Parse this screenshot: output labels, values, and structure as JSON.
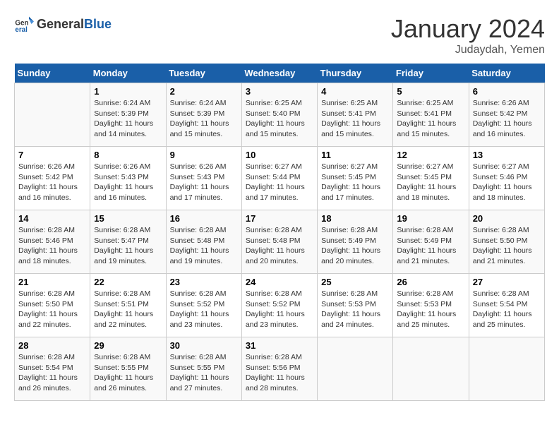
{
  "header": {
    "logo_general": "General",
    "logo_blue": "Blue",
    "month": "January 2024",
    "location": "Judaydah, Yemen"
  },
  "weekdays": [
    "Sunday",
    "Monday",
    "Tuesday",
    "Wednesday",
    "Thursday",
    "Friday",
    "Saturday"
  ],
  "weeks": [
    [
      {
        "day": "",
        "info": ""
      },
      {
        "day": "1",
        "info": "Sunrise: 6:24 AM\nSunset: 5:39 PM\nDaylight: 11 hours and 14 minutes."
      },
      {
        "day": "2",
        "info": "Sunrise: 6:24 AM\nSunset: 5:39 PM\nDaylight: 11 hours and 15 minutes."
      },
      {
        "day": "3",
        "info": "Sunrise: 6:25 AM\nSunset: 5:40 PM\nDaylight: 11 hours and 15 minutes."
      },
      {
        "day": "4",
        "info": "Sunrise: 6:25 AM\nSunset: 5:41 PM\nDaylight: 11 hours and 15 minutes."
      },
      {
        "day": "5",
        "info": "Sunrise: 6:25 AM\nSunset: 5:41 PM\nDaylight: 11 hours and 15 minutes."
      },
      {
        "day": "6",
        "info": "Sunrise: 6:26 AM\nSunset: 5:42 PM\nDaylight: 11 hours and 16 minutes."
      }
    ],
    [
      {
        "day": "7",
        "info": "Sunrise: 6:26 AM\nSunset: 5:42 PM\nDaylight: 11 hours and 16 minutes."
      },
      {
        "day": "8",
        "info": "Sunrise: 6:26 AM\nSunset: 5:43 PM\nDaylight: 11 hours and 16 minutes."
      },
      {
        "day": "9",
        "info": "Sunrise: 6:26 AM\nSunset: 5:43 PM\nDaylight: 11 hours and 17 minutes."
      },
      {
        "day": "10",
        "info": "Sunrise: 6:27 AM\nSunset: 5:44 PM\nDaylight: 11 hours and 17 minutes."
      },
      {
        "day": "11",
        "info": "Sunrise: 6:27 AM\nSunset: 5:45 PM\nDaylight: 11 hours and 17 minutes."
      },
      {
        "day": "12",
        "info": "Sunrise: 6:27 AM\nSunset: 5:45 PM\nDaylight: 11 hours and 18 minutes."
      },
      {
        "day": "13",
        "info": "Sunrise: 6:27 AM\nSunset: 5:46 PM\nDaylight: 11 hours and 18 minutes."
      }
    ],
    [
      {
        "day": "14",
        "info": "Sunrise: 6:28 AM\nSunset: 5:46 PM\nDaylight: 11 hours and 18 minutes."
      },
      {
        "day": "15",
        "info": "Sunrise: 6:28 AM\nSunset: 5:47 PM\nDaylight: 11 hours and 19 minutes."
      },
      {
        "day": "16",
        "info": "Sunrise: 6:28 AM\nSunset: 5:48 PM\nDaylight: 11 hours and 19 minutes."
      },
      {
        "day": "17",
        "info": "Sunrise: 6:28 AM\nSunset: 5:48 PM\nDaylight: 11 hours and 20 minutes."
      },
      {
        "day": "18",
        "info": "Sunrise: 6:28 AM\nSunset: 5:49 PM\nDaylight: 11 hours and 20 minutes."
      },
      {
        "day": "19",
        "info": "Sunrise: 6:28 AM\nSunset: 5:49 PM\nDaylight: 11 hours and 21 minutes."
      },
      {
        "day": "20",
        "info": "Sunrise: 6:28 AM\nSunset: 5:50 PM\nDaylight: 11 hours and 21 minutes."
      }
    ],
    [
      {
        "day": "21",
        "info": "Sunrise: 6:28 AM\nSunset: 5:50 PM\nDaylight: 11 hours and 22 minutes."
      },
      {
        "day": "22",
        "info": "Sunrise: 6:28 AM\nSunset: 5:51 PM\nDaylight: 11 hours and 22 minutes."
      },
      {
        "day": "23",
        "info": "Sunrise: 6:28 AM\nSunset: 5:52 PM\nDaylight: 11 hours and 23 minutes."
      },
      {
        "day": "24",
        "info": "Sunrise: 6:28 AM\nSunset: 5:52 PM\nDaylight: 11 hours and 23 minutes."
      },
      {
        "day": "25",
        "info": "Sunrise: 6:28 AM\nSunset: 5:53 PM\nDaylight: 11 hours and 24 minutes."
      },
      {
        "day": "26",
        "info": "Sunrise: 6:28 AM\nSunset: 5:53 PM\nDaylight: 11 hours and 25 minutes."
      },
      {
        "day": "27",
        "info": "Sunrise: 6:28 AM\nSunset: 5:54 PM\nDaylight: 11 hours and 25 minutes."
      }
    ],
    [
      {
        "day": "28",
        "info": "Sunrise: 6:28 AM\nSunset: 5:54 PM\nDaylight: 11 hours and 26 minutes."
      },
      {
        "day": "29",
        "info": "Sunrise: 6:28 AM\nSunset: 5:55 PM\nDaylight: 11 hours and 26 minutes."
      },
      {
        "day": "30",
        "info": "Sunrise: 6:28 AM\nSunset: 5:55 PM\nDaylight: 11 hours and 27 minutes."
      },
      {
        "day": "31",
        "info": "Sunrise: 6:28 AM\nSunset: 5:56 PM\nDaylight: 11 hours and 28 minutes."
      },
      {
        "day": "",
        "info": ""
      },
      {
        "day": "",
        "info": ""
      },
      {
        "day": "",
        "info": ""
      }
    ]
  ]
}
